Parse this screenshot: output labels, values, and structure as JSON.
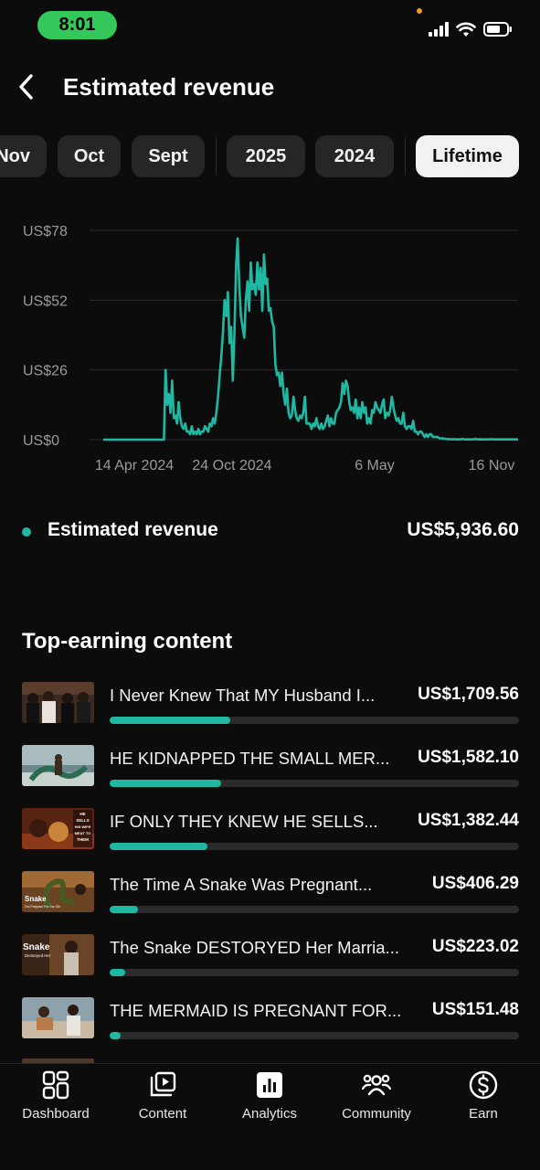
{
  "status_bar": {
    "time": "8:01"
  },
  "header": {
    "title": "Estimated revenue",
    "back_icon": "chevron-left-icon"
  },
  "filters": {
    "chips": [
      "Nov",
      "Oct",
      "Sept",
      "2025",
      "2024",
      "Lifetime"
    ],
    "active": "Lifetime"
  },
  "chart_data": {
    "type": "line",
    "color": "#1fb8a3",
    "y_ticks": [
      "US$78",
      "US$52",
      "US$26",
      "US$0"
    ],
    "ylim": [
      0,
      78
    ],
    "x_ticks": [
      "14 Apr 2024",
      "24 Oct 2024",
      "6 May",
      "16 Nov"
    ],
    "series": [
      {
        "values": [
          0,
          0,
          0,
          0,
          0,
          0,
          0,
          0,
          0,
          0,
          0,
          0,
          0,
          0,
          0,
          0,
          0,
          0,
          0,
          0,
          0,
          0,
          0,
          0,
          0,
          0,
          0,
          0,
          0,
          0,
          0,
          0,
          0,
          0,
          0,
          0,
          0,
          0,
          26,
          13,
          17,
          10,
          22,
          8,
          9,
          6,
          14,
          8,
          5,
          4,
          6,
          3,
          3,
          2,
          5,
          2,
          3,
          2,
          4,
          2,
          3,
          3,
          5,
          4,
          3,
          6,
          5,
          8,
          6,
          10,
          16,
          24,
          31,
          40,
          52,
          46,
          55,
          36,
          42,
          22,
          40,
          65,
          75,
          57,
          46,
          42,
          38,
          52,
          59,
          48,
          66,
          56,
          58,
          54,
          66,
          56,
          64,
          48,
          69,
          58,
          60,
          48,
          49,
          44,
          42,
          28,
          24,
          25,
          20,
          25,
          17,
          13,
          19,
          10,
          8,
          9,
          16,
          11,
          8,
          7,
          9,
          8,
          10,
          16,
          6,
          6,
          6,
          4,
          6,
          5,
          8,
          5,
          4,
          6,
          4,
          5,
          7,
          9,
          5,
          8,
          6,
          6,
          10,
          11,
          12,
          14,
          21,
          17,
          22,
          20,
          14,
          11,
          12,
          10,
          15,
          8,
          12,
          8,
          14,
          10,
          12,
          6,
          8,
          6,
          11,
          10,
          14,
          12,
          11,
          10,
          13,
          15,
          8,
          10,
          9,
          11,
          16,
          12,
          9,
          7,
          8,
          6,
          6,
          10,
          5,
          4,
          5,
          5,
          4,
          7,
          3,
          3,
          2,
          3,
          3,
          2,
          1,
          2,
          1,
          2,
          2,
          1,
          1,
          1,
          1,
          0.5,
          0.5,
          0.5,
          0.3,
          0.3,
          0.2,
          0.2,
          0.2,
          0.1,
          0.2,
          0.1,
          0.1,
          0.1,
          0.1,
          0.3,
          0.1,
          0.1,
          0.1,
          0.1,
          0.1,
          0.1,
          0.1,
          0.3,
          0.1,
          0.1,
          0.1,
          0.1,
          0.1,
          0.1,
          0.1,
          0.1,
          0.1,
          0.2,
          0.1,
          0.1,
          0.1,
          0.1,
          0.1,
          0.1,
          0.1,
          0.1,
          0.1,
          0.1,
          0.1,
          0.1,
          0.1,
          0.1,
          0.1,
          0.1
        ]
      }
    ]
  },
  "summary": {
    "label": "Estimated revenue",
    "value": "US$5,936.60"
  },
  "top_earning": {
    "title": "Top-earning content",
    "items": [
      {
        "title": "I Never Knew That MY Husband I...",
        "value": "US$1,709.56",
        "fraction": 0.295
      },
      {
        "title": "HE KIDNAPPED THE SMALL MER...",
        "value": "US$1,582.10",
        "fraction": 0.273
      },
      {
        "title": "IF ONLY THEY KNEW HE SELLS...",
        "value": "US$1,382.44",
        "fraction": 0.239
      },
      {
        "title": "The Time A Snake Was Pregnant...",
        "value": "US$406.29",
        "fraction": 0.07
      },
      {
        "title": "The Snake DESTORYED Her Marria...",
        "value": "US$223.02",
        "fraction": 0.038
      },
      {
        "title": "THE MERMAID IS PREGNANT FOR...",
        "value": "US$151.48",
        "fraction": 0.026
      }
    ],
    "thumb_text": {
      "item3": [
        "HE",
        "SELLS",
        "HIS WIFE",
        "MEAT TO",
        "THEM"
      ],
      "item4": [
        "Snake",
        "Got Pregnant For Our Girl"
      ],
      "item5": [
        "Snake",
        "Destoryed Her"
      ]
    }
  },
  "tab_bar": {
    "tabs": [
      {
        "label": "Dashboard",
        "icon": "dashboard-grid-icon"
      },
      {
        "label": "Content",
        "icon": "content-play-icon"
      },
      {
        "label": "Analytics",
        "icon": "analytics-bars-icon"
      },
      {
        "label": "Community",
        "icon": "community-people-icon"
      },
      {
        "label": "Earn",
        "icon": "dollar-circle-icon"
      }
    ]
  }
}
